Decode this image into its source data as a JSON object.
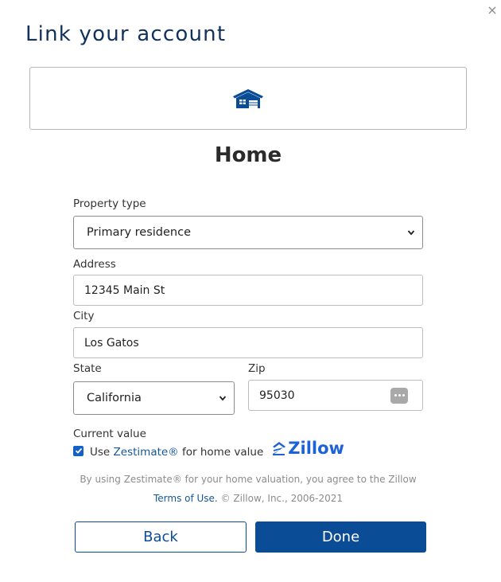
{
  "dialog": {
    "title": "Link your account",
    "close_icon": "close-icon",
    "close_glyph": "×"
  },
  "section": {
    "icon": "home-icon",
    "title": "Home"
  },
  "form": {
    "property_type": {
      "label": "Property type",
      "value": "Primary residence"
    },
    "address": {
      "label": "Address",
      "value": "12345 Main St"
    },
    "city": {
      "label": "City",
      "value": "Los Gatos"
    },
    "state": {
      "label": "State",
      "value": "California"
    },
    "zip": {
      "label": "Zip",
      "value": "95030",
      "icon": "password-manager-icon"
    }
  },
  "current_value": {
    "label": "Current value",
    "checked": true,
    "text_before": "Use",
    "link": "Zestimate®",
    "text_after": "for home value",
    "brand": "Zillow"
  },
  "disclaimer": {
    "text": "By using Zestimate® for your home valuation, you agree to the Zillow",
    "link": "Terms of Use.",
    "copyright": "© Zillow, Inc., 2006-2021"
  },
  "buttons": {
    "back": "Back",
    "done": "Done"
  },
  "colors": {
    "title": "#12315b",
    "primary": "#0b4c96",
    "link": "#14569b",
    "zillow": "#1d62d6"
  }
}
